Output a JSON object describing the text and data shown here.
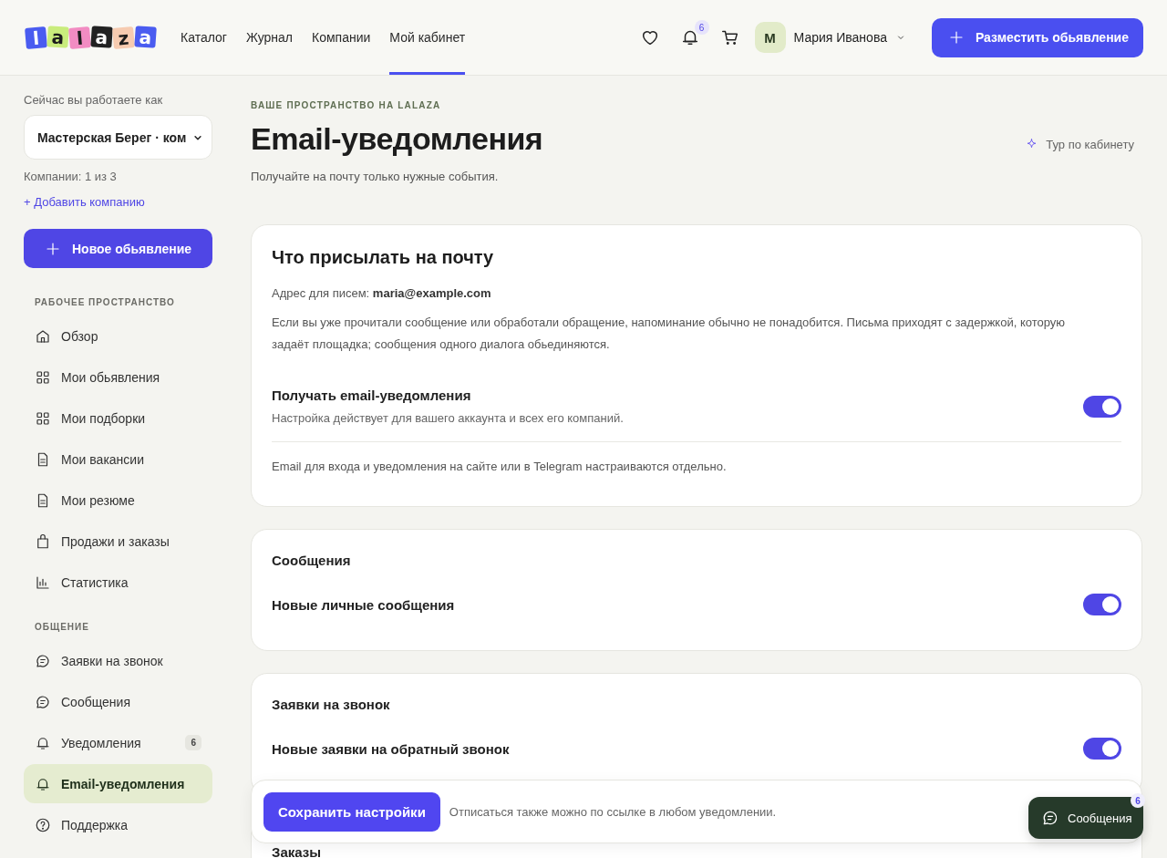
{
  "header": {
    "logo": [
      {
        "letter": "l",
        "color": "#4a5cf0"
      },
      {
        "letter": "a",
        "color": "#c9ec7c"
      },
      {
        "letter": "l",
        "color": "#f28cc2"
      },
      {
        "letter": "a",
        "color": "#222222"
      },
      {
        "letter": "z",
        "color": "#f6cbb0"
      },
      {
        "letter": "a",
        "color": "#4a5cf0"
      }
    ],
    "nav": [
      {
        "label": "Каталог",
        "selected": false
      },
      {
        "label": "Журнал",
        "selected": false
      },
      {
        "label": "Компании",
        "selected": false
      },
      {
        "label": "Мой кабинет",
        "selected": true
      }
    ],
    "notifications_badge": "6",
    "user": {
      "initial": "М",
      "name": "Мария Иванова"
    },
    "cta": "Разместить обьявление"
  },
  "sidebar": {
    "working_as": "Сейчас вы работаете как",
    "company_select": "Мастерская Берег · ком",
    "companies_count": "Компании: 1 из 3",
    "add_company": "+ Добавить компанию",
    "new_listing": "Новое обьявление",
    "sections": [
      {
        "title": "РАБОЧЕЕ ПРОСТРАНСТВО",
        "items": [
          {
            "kind": "home",
            "label": "Обзор",
            "selected": false
          },
          {
            "kind": "grid",
            "label": "Мои обьявления",
            "selected": false
          },
          {
            "kind": "grid",
            "label": "Мои подборки",
            "selected": false
          },
          {
            "kind": "document",
            "label": "Мои вакансии",
            "selected": false
          },
          {
            "kind": "document",
            "label": "Мои резюме",
            "selected": false
          },
          {
            "kind": "bag",
            "label": "Продажи и заказы",
            "selected": false
          },
          {
            "kind": "chart",
            "label": "Статистика",
            "selected": false
          }
        ]
      },
      {
        "title": "ОБЩЕНИЕ",
        "items": [
          {
            "kind": "chat",
            "label": "Заявки на звонок",
            "selected": false
          },
          {
            "kind": "chat",
            "label": "Сообщения",
            "selected": false
          },
          {
            "kind": "bell",
            "label": "Уведомления",
            "selected": false,
            "badge": "6"
          },
          {
            "kind": "bell",
            "label": "Email-уведомления",
            "selected": true
          },
          {
            "kind": "help",
            "label": "Поддержка",
            "selected": false
          }
        ]
      }
    ]
  },
  "main": {
    "eyebrow": "ВАШЕ ПРОСТРАНСТВО НА LALAZA",
    "title": "Email-уведомления",
    "subtitle": "Получайте на почту только нужные события.",
    "tour_link": "Тур по кабинету",
    "cards": [
      {
        "kind": "intro",
        "title": "Что присылать на почту",
        "blocks": [
          {
            "kind": "text",
            "text": "Адрес для писем: **maria@example.com**"
          },
          {
            "kind": "text",
            "text": "Если вы уже прочитали сообщение или обработали обращение, напоминание обычно не понадобится. Письма приходят с задержкой, которую задаёт площадка; сообщения одного диалога обьединяются."
          },
          {
            "kind": "toggle",
            "label": "Получать email-уведомления",
            "description": "Настройка действует для вашего аккаунта и всех его компаний.",
            "on": true
          },
          {
            "kind": "note",
            "text": "Email для входа и уведомления на сайте или в Telegram настраиваются отдельно."
          }
        ]
      },
      {
        "kind": "section",
        "title": "Сообщения",
        "blocks": [
          {
            "kind": "toggle",
            "label": "Новые личные сообщения",
            "on": true
          }
        ]
      },
      {
        "kind": "section",
        "title": "Заявки на звонок",
        "blocks": [
          {
            "kind": "toggle",
            "label": "Новые заявки на обратный звонок",
            "on": true
          }
        ]
      },
      {
        "kind": "section",
        "title": "Заказы"
      }
    ]
  },
  "save_bar": {
    "button": "Сохранить настройки",
    "note": "Отписаться также можно по ссылке в любом уведомлении."
  },
  "chat_button": {
    "label": "Сообщения",
    "badge": "6"
  }
}
